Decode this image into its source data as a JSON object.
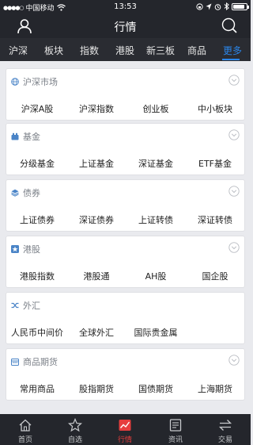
{
  "status_bar": {
    "carrier": "中国移动",
    "time": "13:53",
    "battery_level": 0.9
  },
  "nav": {
    "title": "行情"
  },
  "tabs": [
    {
      "label": "沪深",
      "active": false
    },
    {
      "label": "板块",
      "active": false
    },
    {
      "label": "指数",
      "active": false
    },
    {
      "label": "港股",
      "active": false
    },
    {
      "label": "新三板",
      "active": false
    },
    {
      "label": "商品",
      "active": false
    },
    {
      "label": "更多",
      "active": true
    }
  ],
  "sections": [
    {
      "title": "沪深市场",
      "icon": "globe-icon",
      "items": [
        "沪深A股",
        "沪深指数",
        "创业板",
        "中小板块"
      ]
    },
    {
      "title": "基金",
      "icon": "fund-icon",
      "items": [
        "分级基金",
        "上证基金",
        "深证基金",
        "ETF基金"
      ]
    },
    {
      "title": "债券",
      "icon": "layers-icon",
      "items": [
        "上证债券",
        "深证债券",
        "上证转债",
        "深证转债"
      ]
    },
    {
      "title": "港股",
      "icon": "hk-flower-icon",
      "items": [
        "港股指数",
        "港股通",
        "AH股",
        "国企股"
      ]
    },
    {
      "title": "外汇",
      "icon": "exchange-icon",
      "items": [
        "人民币中间价",
        "全球外汇",
        "国际贵金属"
      ]
    },
    {
      "title": "商品期货",
      "icon": "calendar-icon",
      "items": [
        "常用商品",
        "股指期货",
        "国债期货",
        "上海期货"
      ]
    }
  ],
  "bottom_nav": [
    {
      "label": "首页",
      "icon": "home-icon",
      "active": false
    },
    {
      "label": "自选",
      "icon": "star-icon",
      "active": false
    },
    {
      "label": "行情",
      "icon": "chart-icon",
      "active": true
    },
    {
      "label": "资讯",
      "icon": "news-icon",
      "active": false
    },
    {
      "label": "交易",
      "icon": "trade-icon",
      "active": false
    }
  ],
  "colors": {
    "header_bg": "#24262c",
    "tab_bg": "#2a2c32",
    "accent_blue": "#2a85e8",
    "active_red": "#e63d3d",
    "page_bg": "#e9eaee"
  }
}
